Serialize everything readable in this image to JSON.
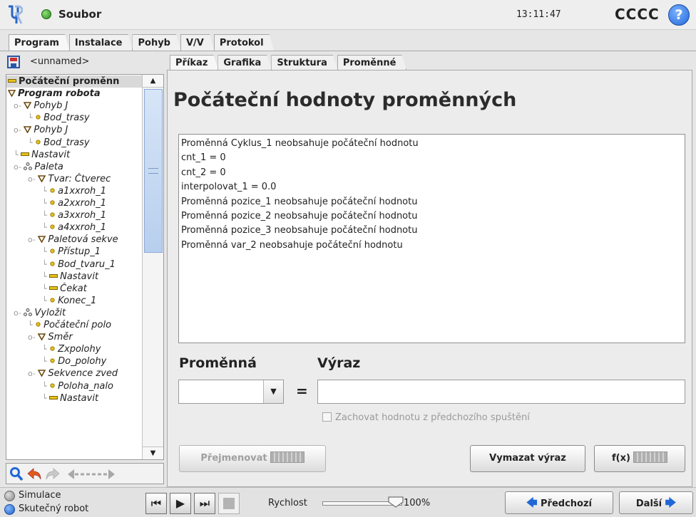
{
  "header": {
    "app_title": "Soubor",
    "time": "13:11:47",
    "robot_name": "CCCC",
    "help": "?"
  },
  "main_tabs": [
    "Program",
    "Instalace",
    "Pohyb",
    "V/V",
    "Protokol"
  ],
  "program": {
    "name": "<unnamed>"
  },
  "tree": [
    {
      "label": "Počáteční proměnn",
      "style": "bold",
      "indent": 0,
      "icon": "set-icon",
      "selected": true
    },
    {
      "label": "Program robota",
      "style": "bolditalic",
      "indent": 0,
      "icon": "collapse-triangle-icon"
    },
    {
      "label": "Pohyb J",
      "style": "italic",
      "indent": 1,
      "icon": "collapse-triangle-icon"
    },
    {
      "label": "Bod_trasy",
      "style": "italic",
      "indent": 2,
      "icon": "waypoint-dot-icon"
    },
    {
      "label": "Pohyb J",
      "style": "italic",
      "indent": 1,
      "icon": "collapse-triangle-icon"
    },
    {
      "label": "Bod_trasy",
      "style": "italic",
      "indent": 2,
      "icon": "waypoint-dot-icon"
    },
    {
      "label": "Nastavit",
      "style": "italic",
      "indent": 1,
      "icon": "set-icon"
    },
    {
      "label": "Paleta",
      "style": "italic",
      "indent": 1,
      "icon": "pallet-icon"
    },
    {
      "label": "Tvar: Čtverec",
      "style": "italic",
      "indent": 2,
      "icon": "collapse-triangle-icon"
    },
    {
      "label": "a1xxroh_1",
      "style": "italic",
      "indent": 3,
      "icon": "waypoint-dot-icon"
    },
    {
      "label": "a2xxroh_1",
      "style": "italic",
      "indent": 3,
      "icon": "waypoint-dot-icon"
    },
    {
      "label": "a3xxroh_1",
      "style": "italic",
      "indent": 3,
      "icon": "waypoint-dot-icon"
    },
    {
      "label": "a4xxroh_1",
      "style": "italic",
      "indent": 3,
      "icon": "waypoint-dot-icon"
    },
    {
      "label": "Paletová sekve",
      "style": "italic",
      "indent": 2,
      "icon": "collapse-triangle-icon"
    },
    {
      "label": "Přístup_1",
      "style": "italic",
      "indent": 3,
      "icon": "waypoint-dot-icon"
    },
    {
      "label": "Bod_tvaru_1",
      "style": "italic",
      "indent": 3,
      "icon": "waypoint-dot-icon"
    },
    {
      "label": "Nastavit",
      "style": "italic",
      "indent": 3,
      "icon": "set-icon"
    },
    {
      "label": "Čekat",
      "style": "italic",
      "indent": 3,
      "icon": "set-icon"
    },
    {
      "label": "Konec_1",
      "style": "italic",
      "indent": 3,
      "icon": "waypoint-dot-icon"
    },
    {
      "label": "Vyložit",
      "style": "italic",
      "indent": 1,
      "icon": "pallet-icon"
    },
    {
      "label": "Počáteční polo",
      "style": "italic",
      "indent": 2,
      "icon": "waypoint-dot-icon"
    },
    {
      "label": "Směr",
      "style": "italic",
      "indent": 2,
      "icon": "collapse-triangle-icon"
    },
    {
      "label": "Zxpolohy",
      "style": "italic",
      "indent": 3,
      "icon": "waypoint-dot-icon"
    },
    {
      "label": "Do_polohy",
      "style": "italic",
      "indent": 3,
      "icon": "waypoint-dot-icon"
    },
    {
      "label": "Sekvence zved",
      "style": "italic",
      "indent": 2,
      "icon": "collapse-triangle-icon"
    },
    {
      "label": "Poloha_nalo",
      "style": "italic",
      "indent": 3,
      "icon": "waypoint-dot-icon"
    },
    {
      "label": "Nastavit",
      "style": "italic",
      "indent": 3,
      "icon": "set-icon"
    }
  ],
  "sub_tabs": [
    "Příkaz",
    "Grafika",
    "Struktura",
    "Proměnné"
  ],
  "page_title": "Počáteční hodnoty proměnných",
  "variables": [
    "Proměnná Cyklus_1 neobsahuje počáteční hodnotu",
    "cnt_1 = 0",
    "cnt_2 = 0",
    "interpolovat_1 = 0.0",
    "Proměnná pozice_1 neobsahuje počáteční hodnotu",
    "Proměnná pozice_2 neobsahuje počáteční hodnotu",
    "Proměnná pozice_3 neobsahuje počáteční hodnotu",
    "Proměnná var_2 neobsahuje počáteční hodnotu"
  ],
  "editor": {
    "var_label": "Proměnná",
    "expr_label": "Výraz",
    "equals": "=",
    "expr_value": "",
    "keep_value_label": "Zachovat hodnotu z předchozího spuštění",
    "rename_button": "Přejmenovat",
    "clear_button": "Vymazat výraz",
    "fx_button": "f(x)"
  },
  "bottom": {
    "simulation": "Simulace",
    "real_robot": "Skutečný robot",
    "speed_label": "Rychlost",
    "speed_value": "100%",
    "speed_fraction": 1.0,
    "prev_button": "Předchozí",
    "next_button": "Další"
  },
  "colors": {
    "accent_blue": "#2267d8",
    "tree_triangle": "#7a5a1a",
    "waypoint_dot": "#c8a400"
  }
}
